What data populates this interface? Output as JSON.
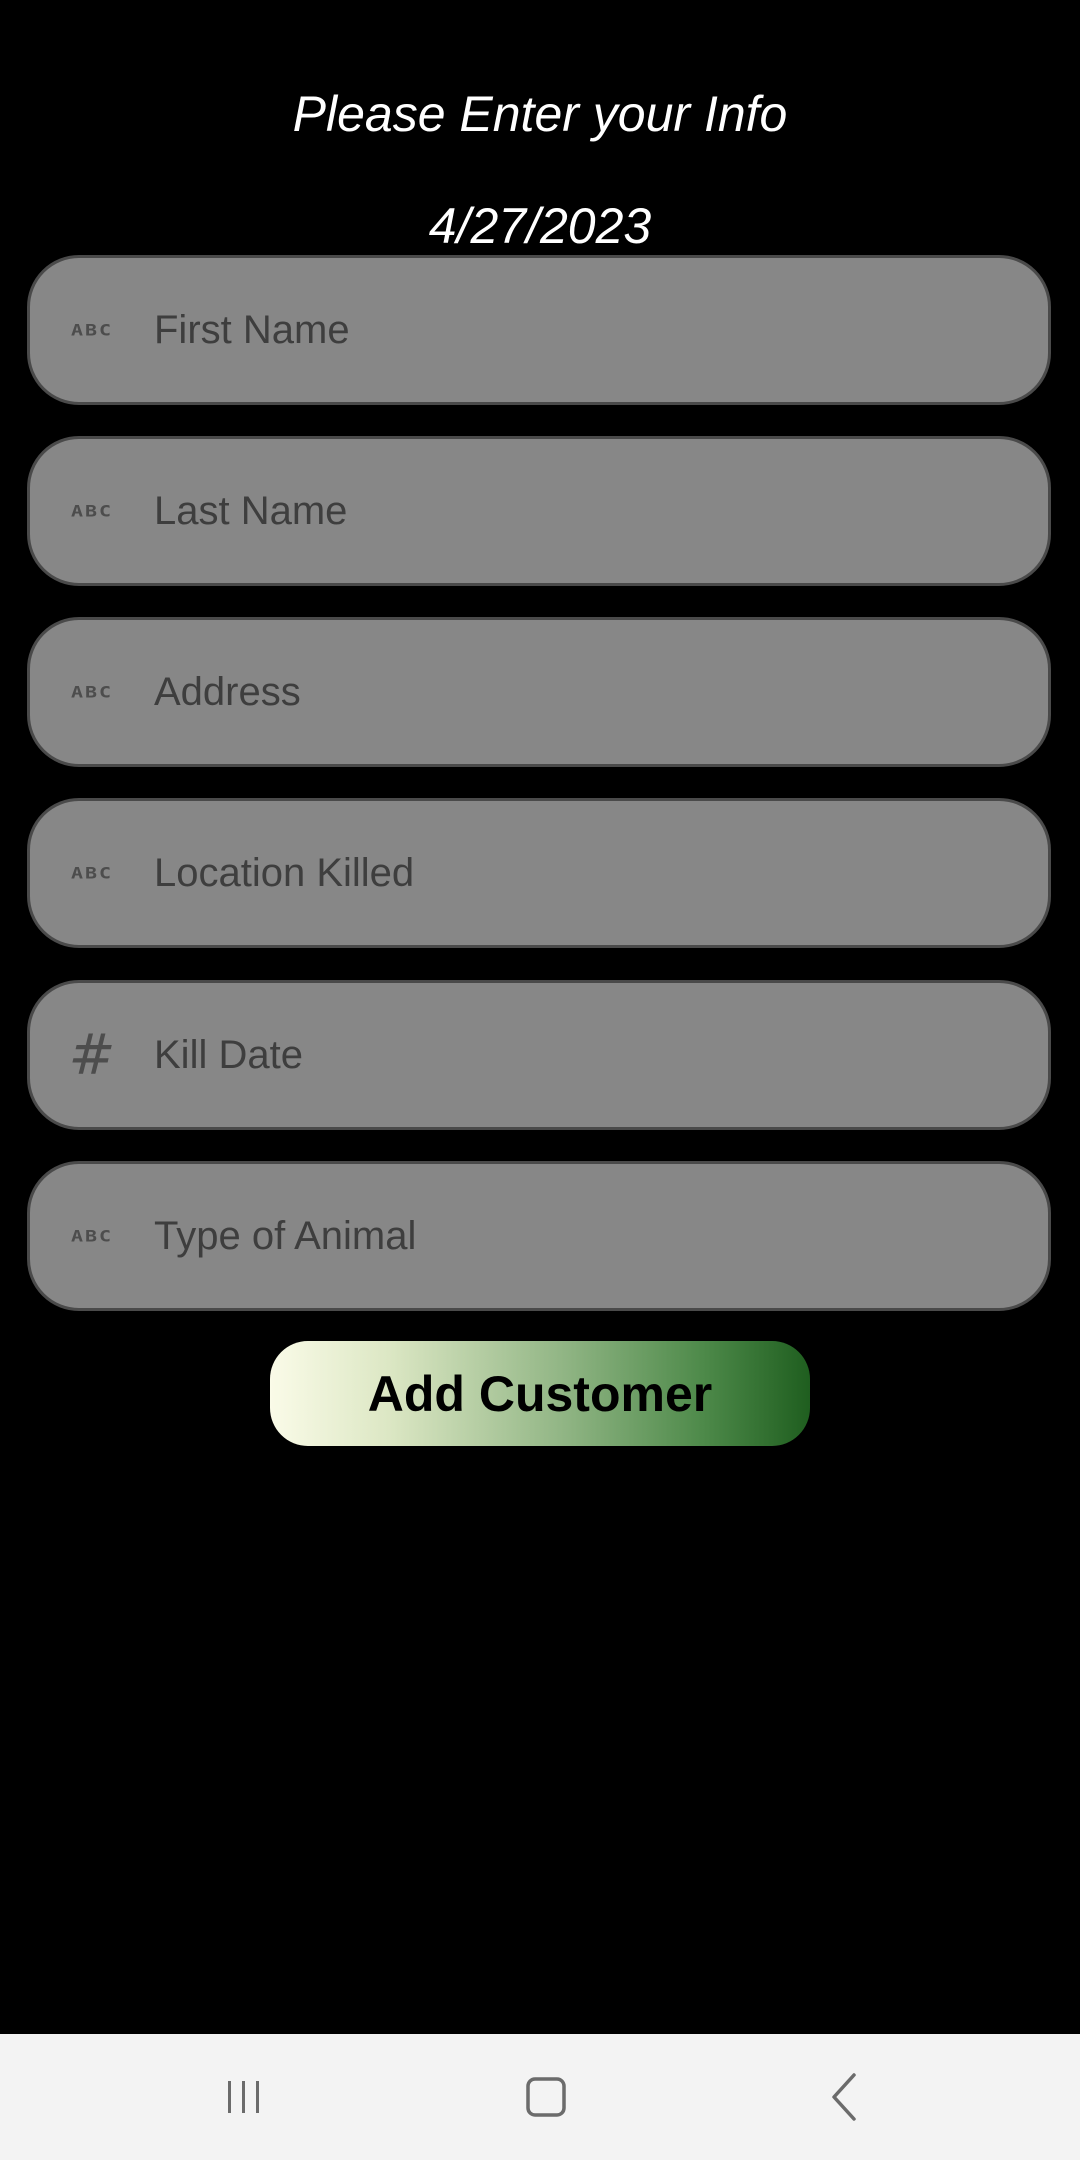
{
  "header": {
    "title": "Please Enter your Info",
    "date": "4/27/2023"
  },
  "form": {
    "fields": [
      {
        "placeholder": "First Name",
        "value": "",
        "icon": "abc-text-icon"
      },
      {
        "placeholder": "Last Name",
        "value": "",
        "icon": "abc-text-icon"
      },
      {
        "placeholder": "Address",
        "value": "",
        "icon": "abc-text-icon"
      },
      {
        "placeholder": "Location Killed",
        "value": "",
        "icon": "abc-text-icon"
      },
      {
        "placeholder": "Kill Date",
        "value": "",
        "icon": "hash-number-icon"
      },
      {
        "placeholder": "Type of Animal",
        "value": "",
        "icon": "abc-text-icon"
      }
    ],
    "submit_label": "Add Customer"
  },
  "icons": {
    "text": "ABC",
    "number": "#"
  },
  "colors": {
    "background": "#000000",
    "field_fill": "#878787",
    "field_border": "#4a4a4a",
    "button_gradient_start": "#fafbe8",
    "button_gradient_end": "#1f5e1f",
    "navbar": "#f3f3f3"
  },
  "navbar": {
    "buttons": [
      "recents-icon",
      "home-icon",
      "back-icon"
    ]
  }
}
